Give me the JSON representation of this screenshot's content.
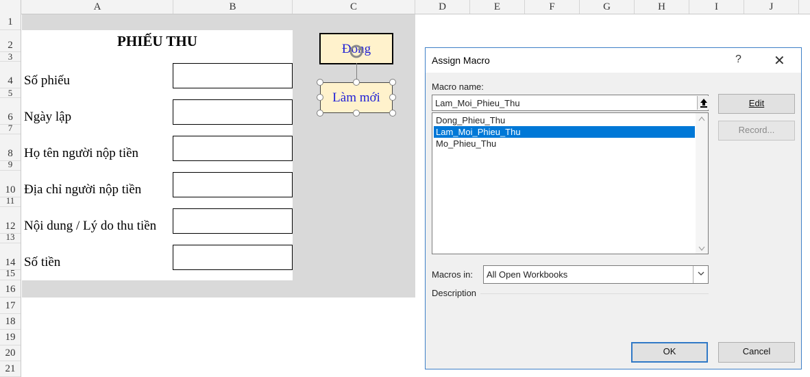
{
  "sheet": {
    "columns": [
      "A",
      "B",
      "C",
      "D",
      "E",
      "F",
      "G",
      "H",
      "I",
      "J"
    ],
    "rows": [
      "1",
      "2",
      "3",
      "4",
      "5",
      "6",
      "7",
      "8",
      "9",
      "10",
      "11",
      "12",
      "13",
      "14",
      "15",
      "16",
      "17",
      "18",
      "19",
      "20",
      "21"
    ],
    "form": {
      "title": "PHIẾU THU",
      "labels": [
        "Số phiếu",
        "Ngày lập",
        "Họ tên người nộp tiền",
        "Địa chỉ người nộp tiền",
        "Nội dung / Lý do thu tiền",
        "Số tiền"
      ]
    },
    "shapes": {
      "close_button": "Đong",
      "refresh_button": "Làm mới"
    },
    "colors": {
      "shape_fill": "#fff2cc",
      "shape_text": "#1f1fd6",
      "sheet_gray": "#d9d9d9"
    }
  },
  "dialog": {
    "title": "Assign Macro",
    "help_label": "?",
    "close_label": "✕",
    "macro_name_label": "Macro name:",
    "macro_name_value": "Lam_Moi_Phieu_Thu",
    "macros": [
      "Dong_Phieu_Thu",
      "Lam_Moi_Phieu_Thu",
      "Mo_Phieu_Thu"
    ],
    "selected_macro": "Lam_Moi_Phieu_Thu",
    "edit_label": "Edit",
    "record_label": "Record...",
    "macros_in_label": "Macros in:",
    "macros_in_value": "All Open Workbooks",
    "description_label": "Description",
    "ok_label": "OK",
    "cancel_label": "Cancel",
    "accent_color": "#0078d7"
  }
}
